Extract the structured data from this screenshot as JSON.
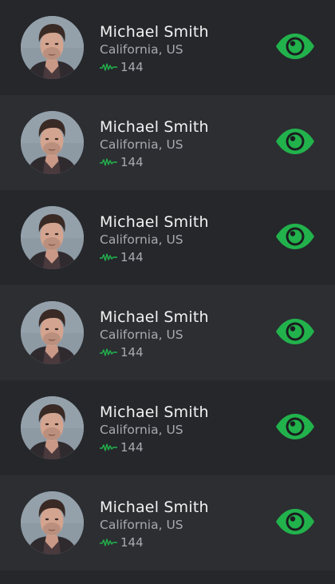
{
  "colors": {
    "accent": "#22b24c",
    "row_dark": "#25272b",
    "row_light": "#2c2e32",
    "name_text": "#f2f2f2",
    "secondary_text": "#a7aaae"
  },
  "icons": {
    "activity": "activity-wave-icon",
    "view": "eye-icon"
  },
  "users": [
    {
      "name": "Michael Smith",
      "location": "California, US",
      "count": "144"
    },
    {
      "name": "Michael Smith",
      "location": "California, US",
      "count": "144"
    },
    {
      "name": "Michael Smith",
      "location": "California, US",
      "count": "144"
    },
    {
      "name": "Michael Smith",
      "location": "California, US",
      "count": "144"
    },
    {
      "name": "Michael Smith",
      "location": "California, US",
      "count": "144"
    },
    {
      "name": "Michael Smith",
      "location": "California, US",
      "count": "144"
    }
  ]
}
